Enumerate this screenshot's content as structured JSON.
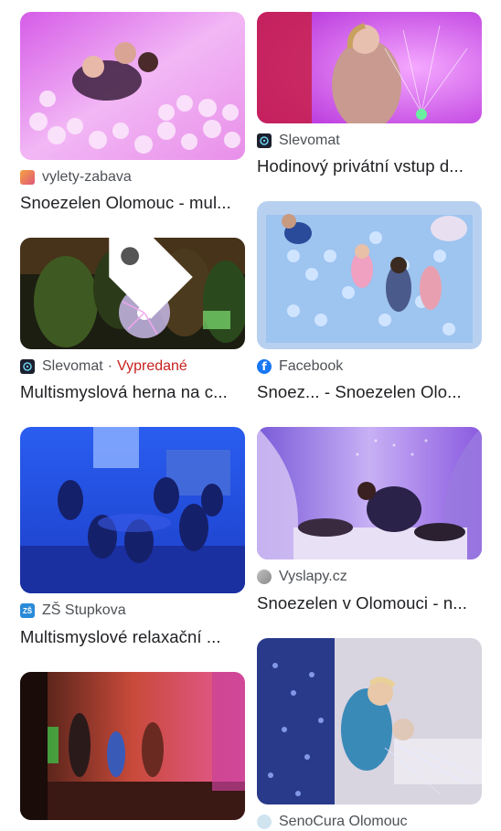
{
  "results": {
    "left": [
      {
        "source": "vylety-zabava",
        "favicon": "vylety-zabava-favicon",
        "title": "Snoezelen Olomouc - mul...",
        "image": "children in ball pit with pink lighting"
      },
      {
        "source": "Slevomat",
        "status": "Vypredané",
        "favicon": "slevomat-favicon",
        "title": "Multismyslová herna na c...",
        "image": "children around plasma ball"
      },
      {
        "source": "ZŠ Stupkova",
        "favicon": "zs-stupkova-favicon",
        "title": "Multismyslové relaxační ...",
        "image": "group sitting in blue sensory room"
      },
      {
        "source": "",
        "favicon": "",
        "title": "",
        "image": "children dancing in red-lit room"
      }
    ],
    "right": [
      {
        "source": "Slevomat",
        "favicon": "slevomat-favicon",
        "title": "Hodinový privátní vstup d...",
        "image": "child touching fiber optic lights"
      },
      {
        "source": "Facebook",
        "favicon": "facebook-favicon",
        "title": "Snoez... - Snoezelen Olo...",
        "image": "children in blue ball pit top view"
      },
      {
        "source": "Vyslapy.cz",
        "favicon": "vyslapy-favicon",
        "title": "Snoezelen v Olomouci - n...",
        "image": "people resting under canopy"
      },
      {
        "source": "SenoCura Olomouc",
        "favicon": "senocura-favicon",
        "title": "",
        "image": "caregiver with patient and bubble tube"
      }
    ]
  },
  "colors": {
    "title": "#202124",
    "source": "#4d5156",
    "sold_out": "#c5221f"
  }
}
